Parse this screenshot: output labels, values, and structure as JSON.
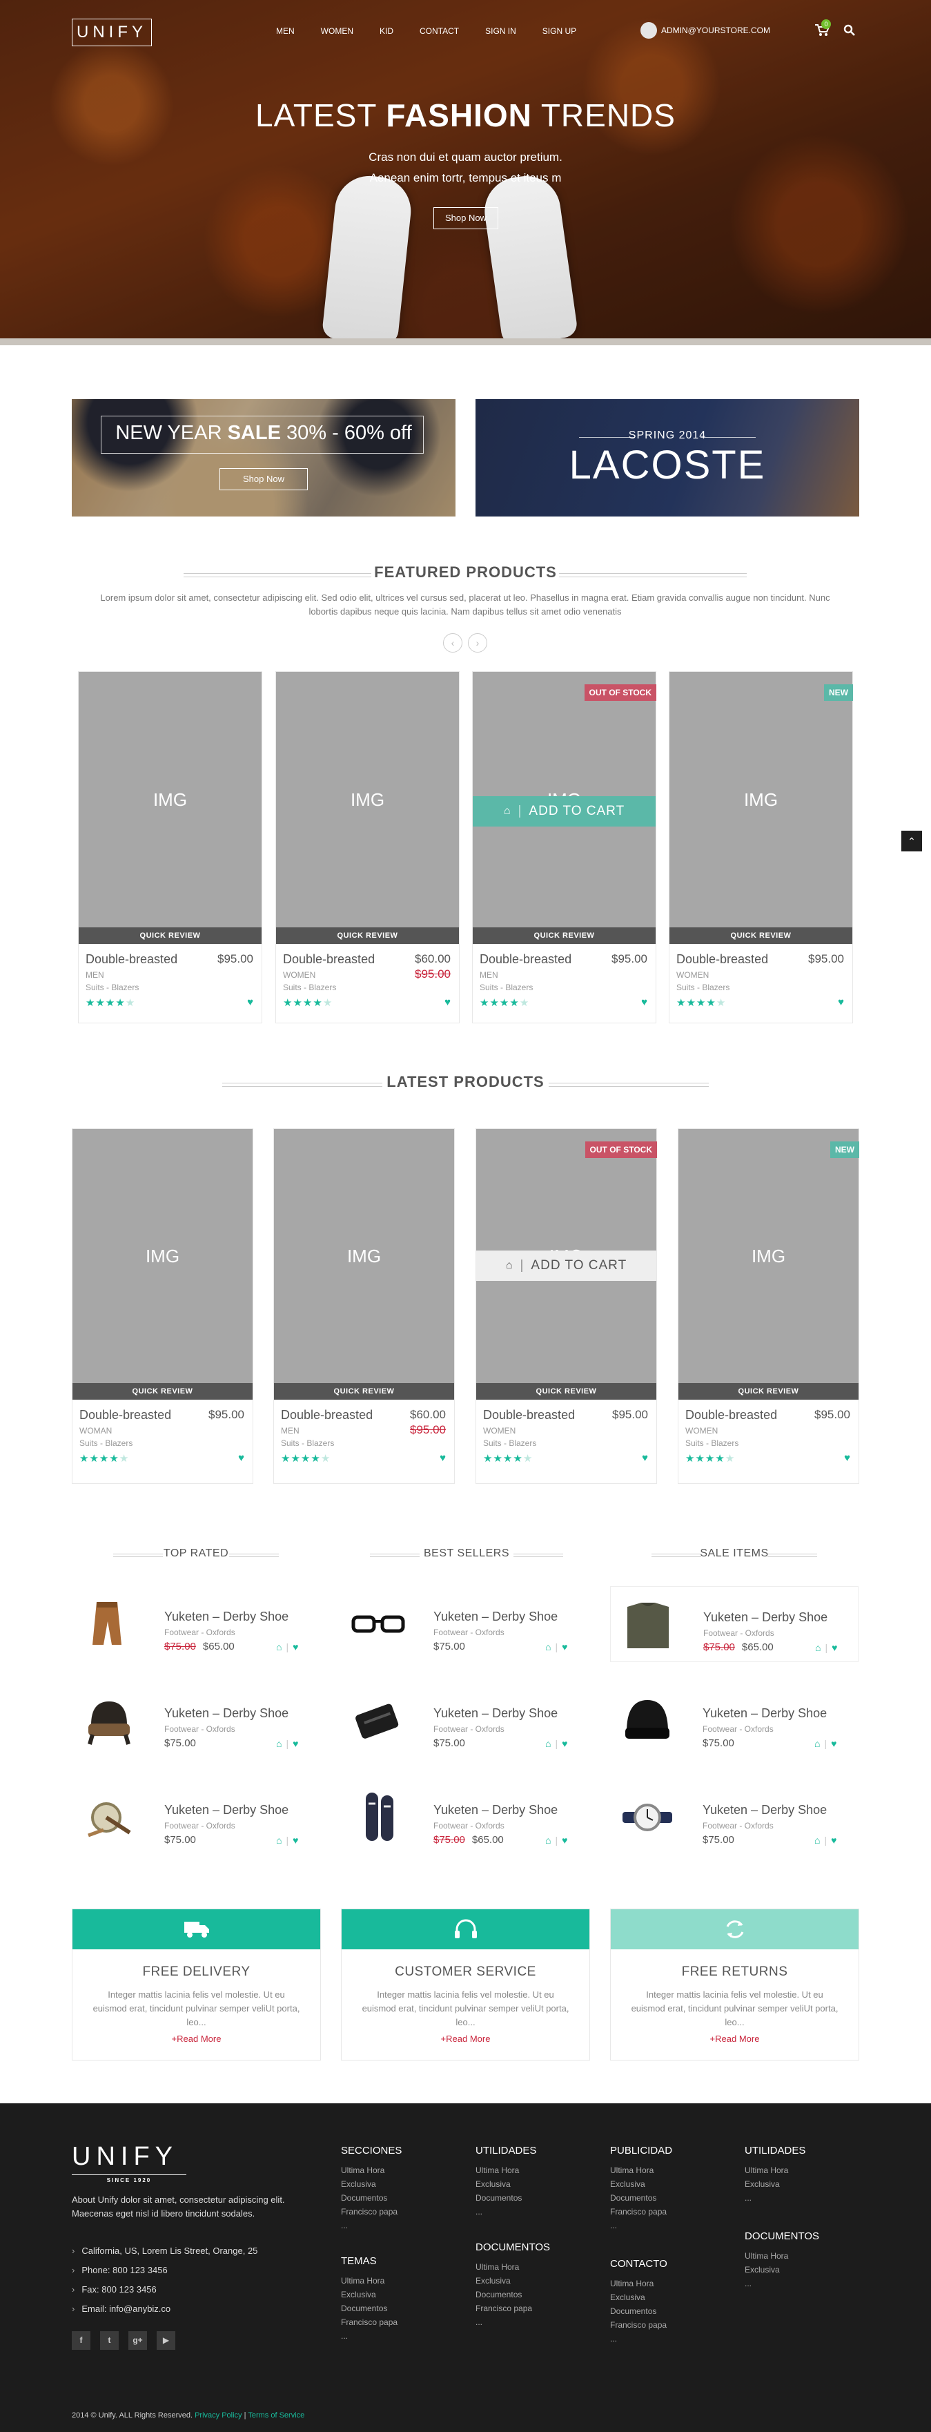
{
  "header": {
    "logo": "UNIFY",
    "nav": [
      "MEN",
      "WOMEN",
      "KID",
      "CONTACT",
      "SIGN IN",
      "SIGN UP"
    ],
    "account": "ADMIN@YOURSTORE.COM",
    "cart_count": "0"
  },
  "hero": {
    "title_light1": "LATEST",
    "title_bold": "FASHION",
    "title_light2": "TRENDS",
    "line1": "Cras non dui et quam auctor pretium.",
    "line2": "Aenean enim tortr, tempus et iteus m",
    "button": "Shop Now"
  },
  "banners": {
    "sale_light": "NEW YEAR",
    "sale_bold": "SALE",
    "sale_rest": "30% - 60% off",
    "sale_button": "Shop Now",
    "lacoste_sub": "SPRING 2014",
    "lacoste_title": "LACOSTE"
  },
  "featured": {
    "title": "FEATURED PRODUCTS",
    "intro": "Lorem ipsum dolor sit amet, consectetur adipiscing elit. Sed odio elit, ultrices vel cursus sed, placerat ut leo. Phasellus in magna erat. Etiam gravida convallis augue non tincidunt. Nunc lobortis dapibus neque quis lacinia. Nam dapibus tellus sit amet odio venenatis",
    "img_label": "IMG",
    "quick_review": "QUICK REVIEW",
    "add_to_cart": "ADD TO CART",
    "products": [
      {
        "name": "Double-breasted",
        "price": "$95.00",
        "old": "",
        "cat": "MEN",
        "sub": "Suits - Blazers",
        "badge": "",
        "rating": 4
      },
      {
        "name": "Double-breasted",
        "price": "$60.00",
        "old": "$95.00",
        "cat": "WOMEN",
        "sub": "Suits - Blazers",
        "badge": "",
        "rating": 4
      },
      {
        "name": "Double-breasted",
        "price": "$95.00",
        "old": "",
        "cat": "MEN",
        "sub": "Suits - Blazers",
        "badge": "OUT OF STOCK",
        "rating": 4
      },
      {
        "name": "Double-breasted",
        "price": "$95.00",
        "old": "",
        "cat": "WOMEN",
        "sub": "Suits - Blazers",
        "badge": "NEW",
        "rating": 4
      }
    ]
  },
  "latest": {
    "title": "LATEST PRODUCTS",
    "products": [
      {
        "name": "Double-breasted",
        "price": "$95.00",
        "old": "",
        "cat": "WOMAN",
        "sub": "Suits - Blazers",
        "badge": "",
        "rating": 4
      },
      {
        "name": "Double-breasted",
        "price": "$60.00",
        "old": "$95.00",
        "cat": "MEN",
        "sub": "Suits - Blazers",
        "badge": "",
        "rating": 4
      },
      {
        "name": "Double-breasted",
        "price": "$95.00",
        "old": "",
        "cat": "WOMEN",
        "sub": "Suits - Blazers",
        "badge": "OUT OF STOCK",
        "rating": 4
      },
      {
        "name": "Double-breasted",
        "price": "$95.00",
        "old": "",
        "cat": "WOMEN",
        "sub": "Suits - Blazers",
        "badge": "NEW",
        "rating": 4
      }
    ]
  },
  "lists": {
    "top_rated": "TOP RATED",
    "best_sellers": "BEST SELLERS",
    "sale_items": "SALE ITEMS",
    "item_name": "Yuketen – Derby Shoe",
    "item_cat": "Footwear - Oxfords",
    "items": [
      {
        "thumb": "pants-icon",
        "price": "$65.00",
        "old": "$75.00"
      },
      {
        "thumb": "glasses-icon",
        "price": "$75.00",
        "old": ""
      },
      {
        "thumb": "sweater-icon",
        "price": "$65.00",
        "old": "$75.00"
      },
      {
        "thumb": "hat-icon",
        "price": "$75.00",
        "old": ""
      },
      {
        "thumb": "wallet-icon",
        "price": "$75.00",
        "old": ""
      },
      {
        "thumb": "beanie-icon",
        "price": "$75.00",
        "old": ""
      },
      {
        "thumb": "belt-icon",
        "price": "$75.00",
        "old": ""
      },
      {
        "thumb": "sneaker-icon",
        "price": "$65.00",
        "old": "$75.00"
      },
      {
        "thumb": "watch-icon",
        "price": "$75.00",
        "old": ""
      }
    ]
  },
  "services": [
    {
      "icon": "truck-icon",
      "title": "FREE DELIVERY",
      "text": "Integer mattis lacinia felis vel molestie. Ut eu euismod erat, tincidunt pulvinar semper veliUt porta, leo...",
      "more": "+Read More",
      "color": "#18ba9b"
    },
    {
      "icon": "headset-icon",
      "title": "CUSTOMER SERVICE",
      "text": "Integer mattis lacinia felis vel molestie. Ut eu euismod erat, tincidunt pulvinar semper veliUt porta, leo...",
      "more": "+Read More",
      "color": "#18ba9b"
    },
    {
      "icon": "refresh-icon",
      "title": "FREE RETURNS",
      "text": "Integer mattis lacinia felis vel molestie. Ut eu euismod erat, tincidunt pulvinar semper veliUt porta, leo...",
      "more": "+Read More",
      "color": "#8edccb"
    }
  ],
  "footer": {
    "logo": "UNIFY",
    "since": "SINCE 1920",
    "about": "About Unify dolor sit amet, consectetur adipiscing elit. Maecenas eget nisl id libero tincidunt sodales.",
    "contact": [
      "California, US, Lorem Lis Street, Orange, 25",
      "Phone: 800 123 3456",
      "Fax: 800 123 3456",
      "Email: info@anybiz.co"
    ],
    "social": [
      "f",
      "t",
      "g+",
      "▶"
    ],
    "columns": [
      {
        "title": "SECCIONES",
        "links": [
          "Ultima Hora",
          "Exclusiva",
          "Documentos",
          "Francisco papa",
          "..."
        ]
      },
      {
        "title": "UTILIDADES",
        "links": [
          "Ultima Hora",
          "Exclusiva",
          "Documentos",
          "..."
        ]
      },
      {
        "title": "PUBLICIDAD",
        "links": [
          "Ultima Hora",
          "Exclusiva",
          "Documentos",
          "Francisco papa",
          "..."
        ]
      },
      {
        "title": "UTILIDADES",
        "links": [
          "Ultima Hora",
          "Exclusiva",
          "..."
        ]
      },
      {
        "title": "TEMAS",
        "links": [
          "Ultima Hora",
          "Exclusiva",
          "Documentos",
          "Francisco papa",
          "..."
        ]
      },
      {
        "title": "DOCUMENTOS",
        "links": [
          "Ultima Hora",
          "Exclusiva",
          "Documentos",
          "Francisco papa",
          "..."
        ]
      },
      {
        "title": "CONTACTO",
        "links": [
          "Ultima Hora",
          "Exclusiva",
          "Documentos",
          "Francisco papa",
          "..."
        ]
      },
      {
        "title": "DOCUMENTOS",
        "links": [
          "Ultima Hora",
          "Exclusiva",
          "..."
        ]
      }
    ],
    "copyright": "2014 © Unify. ALL Rights Reserved.",
    "privacy": "Privacy Policy",
    "separator": "|",
    "terms": "Terms of Service"
  },
  "colors": {
    "accent": "#18ba9b",
    "sale_red": "#c9253c",
    "badge_out": "#c95366",
    "badge_new": "#5bb8a8",
    "footer_bg": "#1c1c1c"
  }
}
